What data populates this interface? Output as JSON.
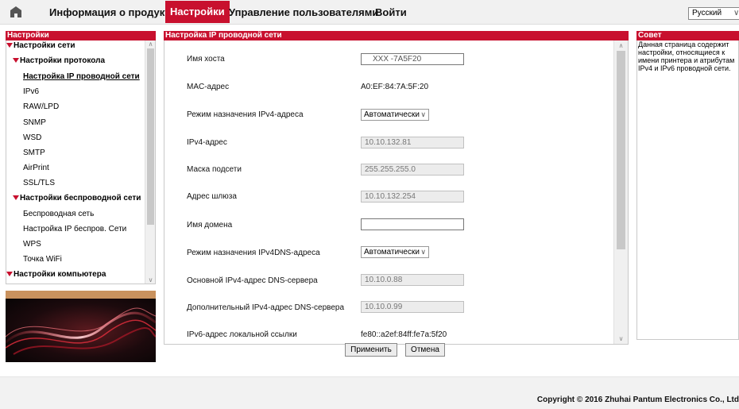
{
  "topnav": {
    "home_icon": "home-icon",
    "items": [
      "Информация о продукте",
      "Настройки",
      "Управление пользователями",
      "Войти"
    ],
    "active": "Настройки",
    "language": "Русский"
  },
  "sidebar": {
    "title": "Настройки",
    "items": [
      {
        "label": "Настройки сети",
        "level": 0,
        "expanded": true
      },
      {
        "label": "Настройки протокола",
        "level": 1,
        "expanded": true
      },
      {
        "label": "Настройка IP проводной сети",
        "level": 2,
        "selected": true
      },
      {
        "label": "IPv6",
        "level": 2
      },
      {
        "label": "RAW/LPD",
        "level": 2
      },
      {
        "label": "SNMP",
        "level": 2
      },
      {
        "label": "WSD",
        "level": 2
      },
      {
        "label": "SMTP",
        "level": 2
      },
      {
        "label": "AirPrint",
        "level": 2
      },
      {
        "label": "SSL/TLS",
        "level": 2
      },
      {
        "label": "Настройки беспроводной сети",
        "level": 1,
        "expanded": true
      },
      {
        "label": "Беспроводная сеть",
        "level": 2
      },
      {
        "label": "Настройка IP беспров. Сети",
        "level": 2
      },
      {
        "label": "WPS",
        "level": 2
      },
      {
        "label": "Точка WiFi",
        "level": 2
      },
      {
        "label": "Настройки компьютера",
        "level": 0,
        "expanded": true
      }
    ]
  },
  "main": {
    "title": "Настройка IP проводной сети",
    "fields": [
      {
        "label": "Имя хоста",
        "type": "input",
        "value": "XXX -7A5F20"
      },
      {
        "label": "MAC-адрес",
        "type": "text",
        "value": "A0:EF:84:7A:5F:20"
      },
      {
        "label": "Режим назначения IPv4-адреса",
        "type": "select",
        "value": "Автоматически"
      },
      {
        "label": "IPv4-адрес",
        "type": "readonly",
        "value": "10.10.132.81"
      },
      {
        "label": "Маска подсети",
        "type": "readonly",
        "value": "255.255.255.0"
      },
      {
        "label": "Адрес шлюза",
        "type": "readonly",
        "value": "10.10.132.254"
      },
      {
        "label": "Имя домена",
        "type": "input",
        "value": ""
      },
      {
        "label": "Режим назначения IPv4DNS-адреса",
        "type": "select",
        "value": "Автоматически"
      },
      {
        "label": "Основной IPv4-адрес DNS-сервера",
        "type": "readonly",
        "value": "10.10.0.88"
      },
      {
        "label": "Дополнительный IPv4-адрес DNS-сервера",
        "type": "readonly",
        "value": "10.10.0.99"
      },
      {
        "label": "IPv6-адрес локальной ссылки",
        "type": "text",
        "value": "fe80::a2ef:84ff:fe7a:5f20"
      }
    ],
    "apply_label": "Применить",
    "cancel_label": "Отмена"
  },
  "tip": {
    "title": "Совет",
    "text": "Данная страница содержит настройки, относящиеся к имени принтера и атрибутам IPv4 и IPv6 проводной сети."
  },
  "footer": {
    "copyright": "Copyright © 2016 Zhuhai Pantum Electronics Co., Ltd"
  },
  "colors": {
    "accent": "#c8102e",
    "banner_stripe": "#c9925e"
  }
}
